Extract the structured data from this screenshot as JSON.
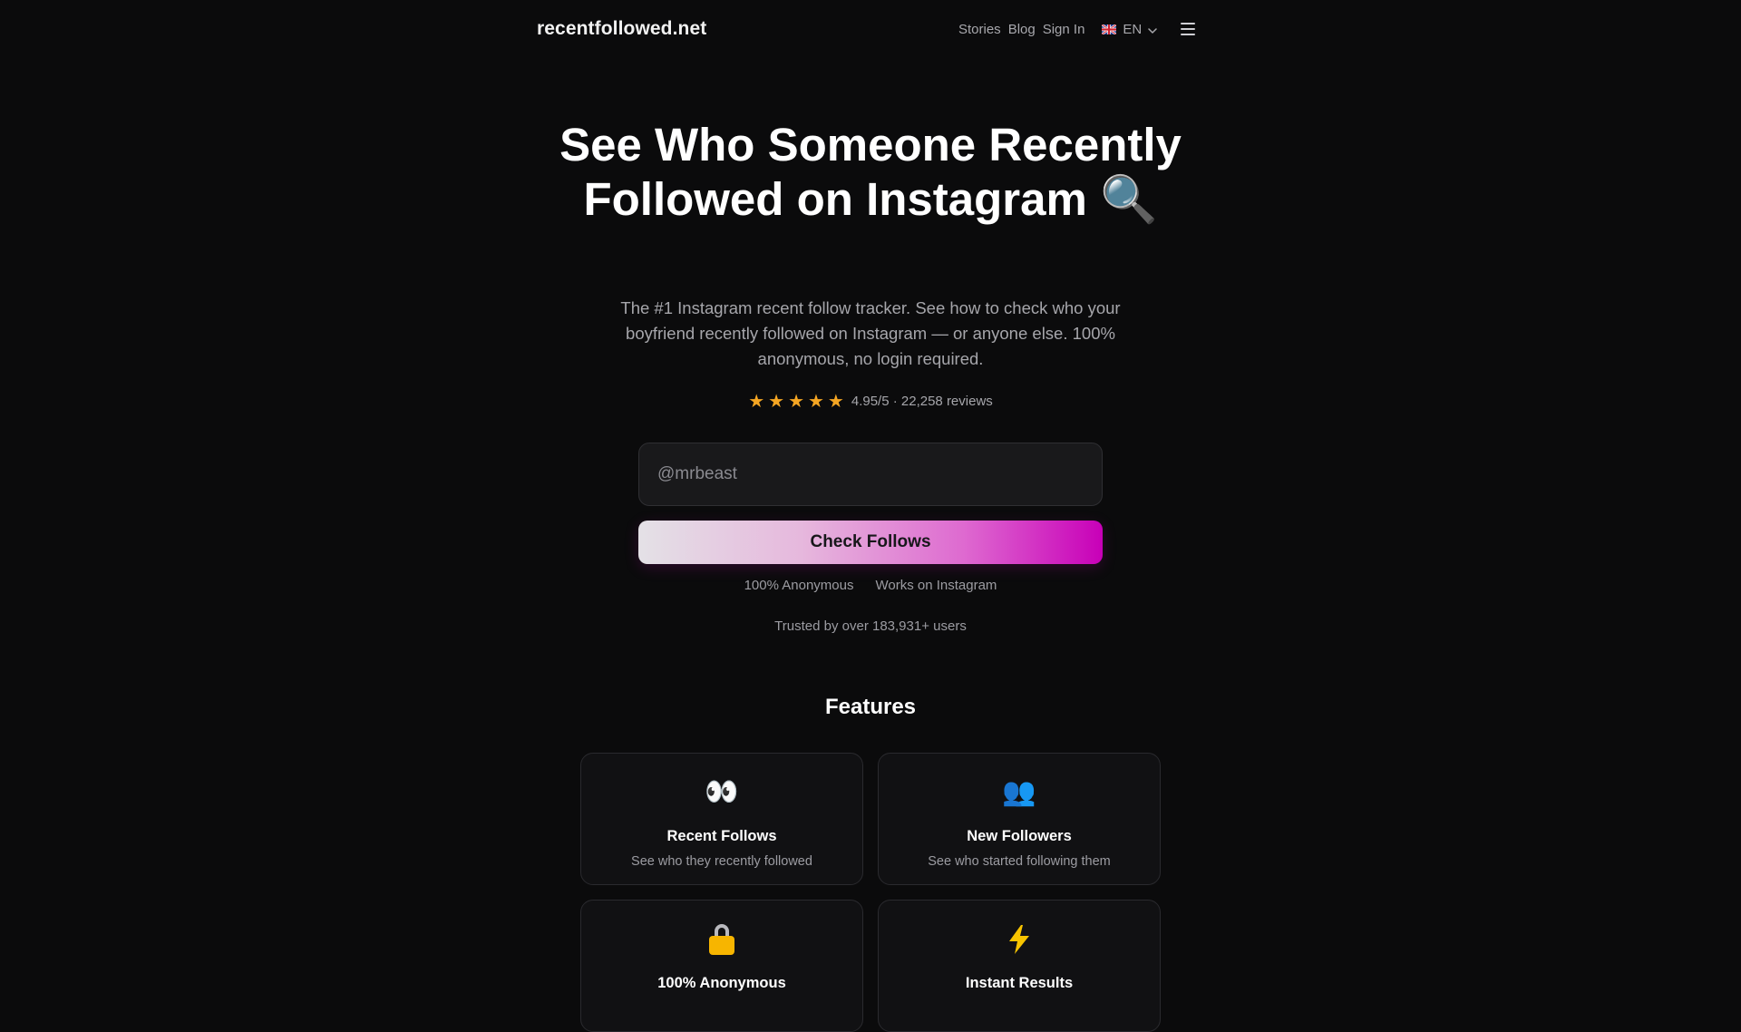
{
  "header": {
    "logo": "recentfollowed.net",
    "nav": [
      "Stories",
      "Blog",
      "Sign In"
    ],
    "language": "EN",
    "flag_icon": "uk-flag-icon",
    "menu_icon": "hamburger-menu-icon"
  },
  "hero": {
    "title": "See Who Someone Recently Followed on Instagram 🔍",
    "subtitle": "The #1 Instagram recent follow tracker. See how to check who your boyfriend recently followed on Instagram — or anyone else. 100% anonymous, no login required.",
    "stars": "★★★★★",
    "rating_value": 4.95,
    "rating_text": "4.95/5 · 22,258 reviews"
  },
  "search": {
    "placeholder": "@mrbeast",
    "value": ""
  },
  "cta": {
    "label": "Check Follows"
  },
  "badges": [
    "100% Anonymous",
    "Works on Instagram"
  ],
  "trusted": "Trusted by over 183,931+ users",
  "features": {
    "title": "Features",
    "items": [
      {
        "icon": "👀",
        "icon_name": "eyes-icon",
        "title": "Recent Follows",
        "desc": "See who they recently followed"
      },
      {
        "icon": "👥",
        "icon_name": "people-icon",
        "title": "New Followers",
        "desc": "See who started following them"
      },
      {
        "icon": "🔒",
        "icon_name": "lock-icon",
        "title": "100% Anonymous",
        "desc": ""
      },
      {
        "icon": "⚡",
        "icon_name": "lightning-icon",
        "title": "Instant Results",
        "desc": ""
      }
    ]
  },
  "colors": {
    "background": "#0b0b0c",
    "star": "#f5a623",
    "cta_gradient_end": "#c800b8"
  }
}
